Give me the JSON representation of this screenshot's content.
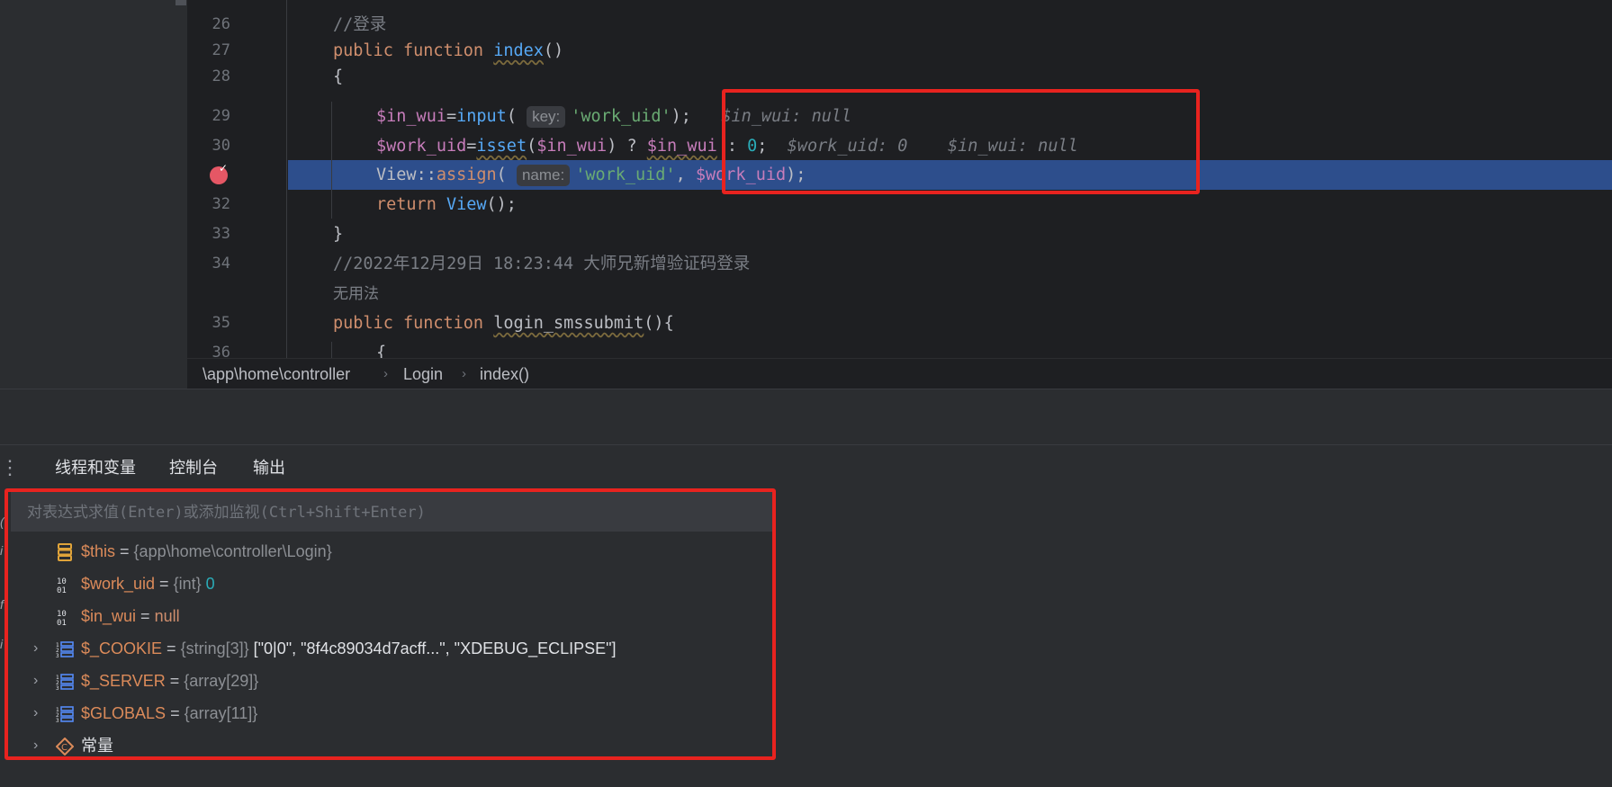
{
  "editor": {
    "lines": [
      {
        "num": "26",
        "comment": "//登录"
      },
      {
        "num": "27",
        "kw": "public function",
        "fn": "index",
        "tail": "()"
      },
      {
        "num": "28",
        "text": "{"
      },
      {
        "num": "29",
        "var1": "$in_wui",
        "op": "=",
        "fn": "input",
        "paren": "(",
        "hint": "key:",
        "str": "'work_uid'",
        "end": ");",
        "inline": "$in_wui: null"
      },
      {
        "num": "30",
        "var1": "$work_uid",
        "op": "=",
        "fn": "isset",
        "paren": "(",
        "var2": "$in_wui",
        "mid": ") ? ",
        "var3": "$in_wui",
        "colon": " : ",
        "num_val": "0",
        "end": ";",
        "inline1": "$work_uid: 0",
        "inline2": "$in_wui: null"
      },
      {
        "num": "",
        "cls": "View",
        "dc": "::",
        "fn": "assign",
        "paren": "(",
        "hint": "name:",
        "str": "'work_uid'",
        "comma": ", ",
        "var": "$work_uid",
        "end": ");"
      },
      {
        "num": "32",
        "kw": "return",
        "fn": "View",
        "tail": "();"
      },
      {
        "num": "33",
        "text": "}"
      },
      {
        "num": "34",
        "comment": "//2022年12月29日 18:23:44 大师兄新增验证码登录"
      },
      {
        "num": "",
        "comment": "无用法"
      },
      {
        "num": "35",
        "kw": "public function",
        "fn": "login_smssubmit",
        "tail": "(){"
      },
      {
        "num": "36",
        "text": "{"
      }
    ]
  },
  "breadcrumb": {
    "path": "\\app\\home\\controller",
    "class": "Login",
    "method": "index()",
    "sep": "›"
  },
  "debug": {
    "menu_icon": "⋮",
    "tabs": [
      "线程和变量",
      "控制台",
      "输出"
    ],
    "eval_placeholder": "对表达式求值(Enter)或添加监视(Ctrl+Shift+Enter)",
    "variables": [
      {
        "name": "$this",
        "eq": " = ",
        "type": "{app\\home\\controller\\Login}",
        "value": "",
        "icon": "object-icon",
        "expandable": false
      },
      {
        "name": "$work_uid",
        "eq": " = ",
        "type": "{int} ",
        "value": "0",
        "icon": "numeric-icon",
        "expandable": false
      },
      {
        "name": "$in_wui",
        "eq": " = ",
        "type": "",
        "value": "null",
        "icon": "numeric-icon",
        "expandable": false
      },
      {
        "name": "$_COOKIE",
        "eq": " = ",
        "type": "{string[3]} ",
        "value": "[\"0|0\", \"8f4c89034d7acff...\", \"XDEBUG_ECLIPSE\"]",
        "icon": "array-icon",
        "expandable": true
      },
      {
        "name": "$_SERVER",
        "eq": " = ",
        "type": "{array[29]}",
        "value": "",
        "icon": "array-icon",
        "expandable": true
      },
      {
        "name": "$GLOBALS",
        "eq": " = ",
        "type": "{array[11]}",
        "value": "",
        "icon": "array-icon",
        "expandable": true
      },
      {
        "name": "常量",
        "eq": "",
        "type": "",
        "value": "",
        "icon": "constant-icon",
        "expandable": true
      }
    ]
  },
  "colors": {
    "highlight_box": "#e8231f",
    "current_line": "#2d4e8c",
    "breakpoint": "#e55765"
  }
}
